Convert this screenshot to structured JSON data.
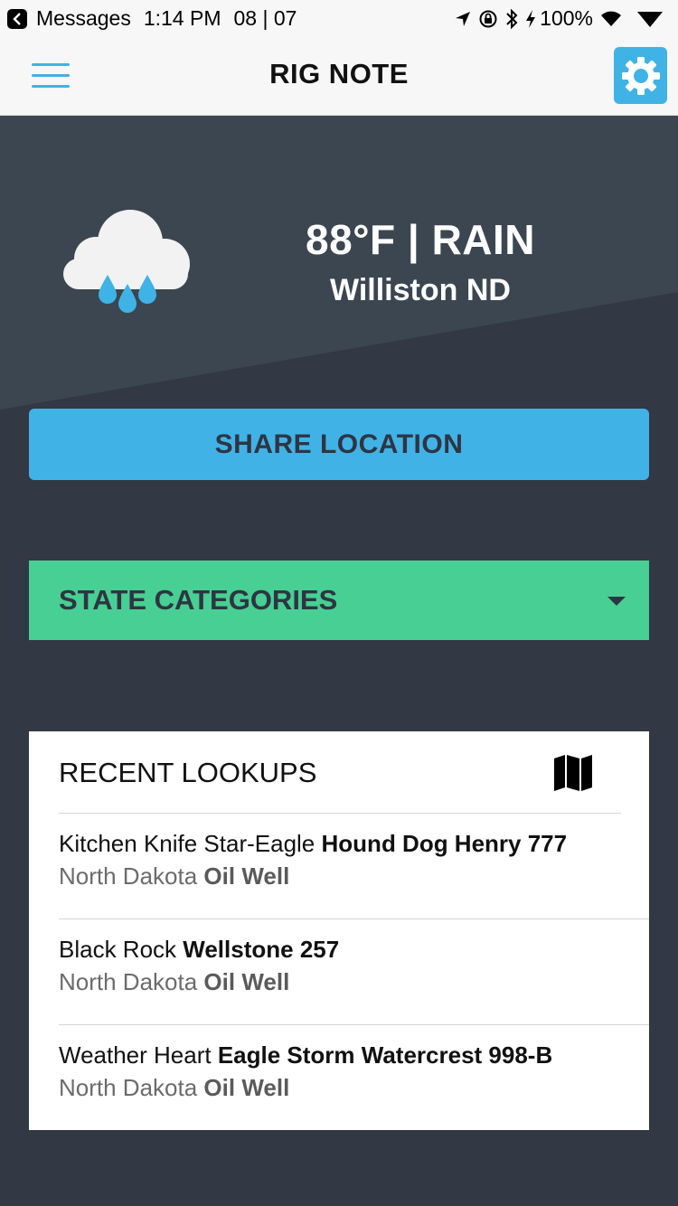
{
  "status_bar": {
    "back_app": "Messages",
    "time": "1:14 PM",
    "date": "08 | 07",
    "battery": "100%"
  },
  "header": {
    "title": "RIG NOTE"
  },
  "weather": {
    "temperature_condition": "88°F | RAIN",
    "location": "Williston ND"
  },
  "actions": {
    "share_location": "SHARE LOCATION",
    "state_categories": "STATE CATEGORIES"
  },
  "recent_lookups": {
    "title": "RECENT LOOKUPS",
    "items": [
      {
        "operator": "Kitchen Knife Star-Eagle",
        "name": "Hound Dog Henry 777",
        "state": "North Dakota",
        "type": "Oil Well"
      },
      {
        "operator": "Black Rock",
        "name": "Wellstone 257",
        "state": "North Dakota",
        "type": "Oil Well"
      },
      {
        "operator": "Weather Heart",
        "name": "Eagle Storm Watercrest 998-B",
        "state": "North Dakota",
        "type": "Oil Well"
      }
    ]
  },
  "colors": {
    "accent_blue": "#41b2e6",
    "accent_green": "#48cf93",
    "background_dark": "#323844",
    "hero_light": "#3c4651"
  },
  "icons": [
    "back-icon",
    "location-arrow-icon",
    "rotation-lock-icon",
    "bluetooth-icon",
    "charging-icon",
    "wifi-icon",
    "signal-icon",
    "menu-icon",
    "gear-icon",
    "rain-cloud-icon",
    "caret-down-icon",
    "map-icon"
  ]
}
